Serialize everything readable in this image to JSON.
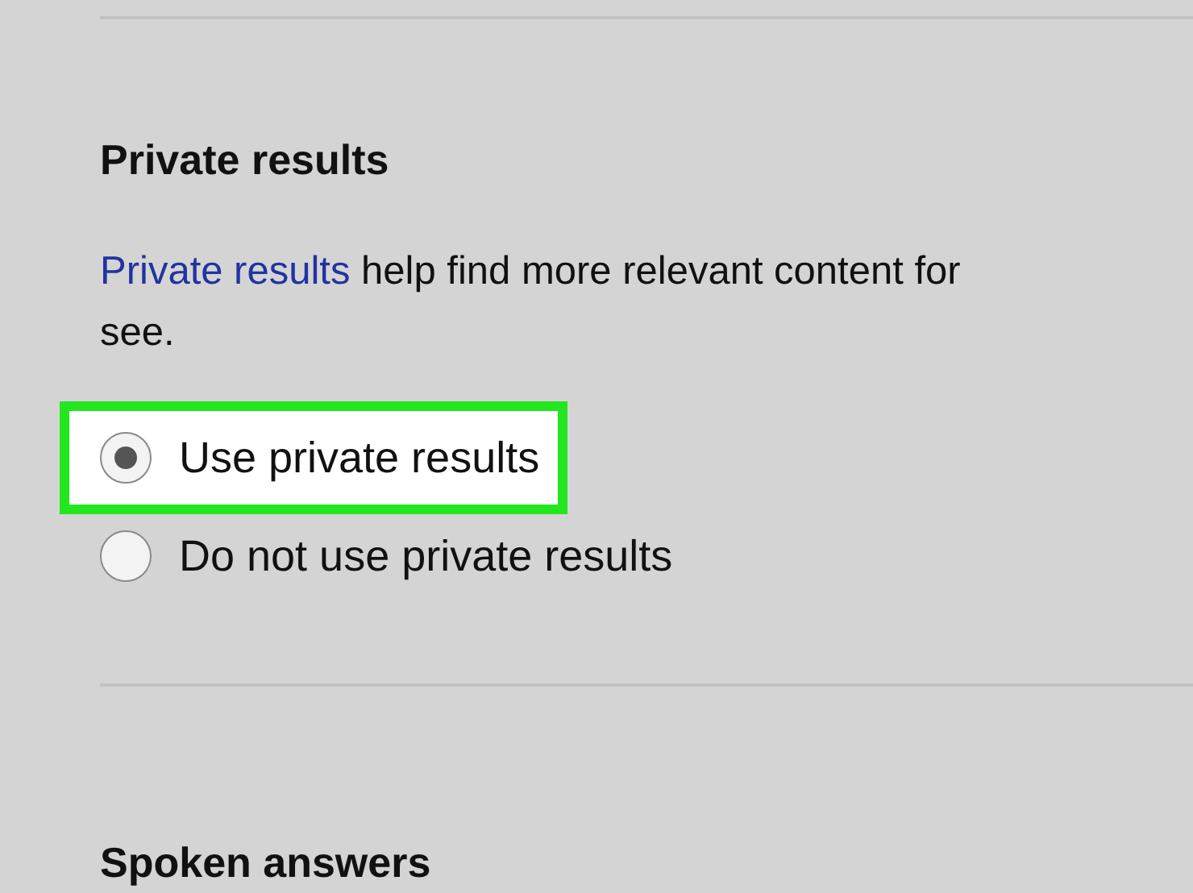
{
  "sections": [
    {
      "heading": "Private results",
      "description": {
        "link": "Private results",
        "text": " help find more relevant content for",
        "continuation": "see."
      },
      "options": [
        {
          "label": "Use private results",
          "selected": true,
          "highlighted": true
        },
        {
          "label": "Do not use private results",
          "selected": false,
          "highlighted": false
        }
      ]
    },
    {
      "heading": "Spoken answers"
    }
  ]
}
